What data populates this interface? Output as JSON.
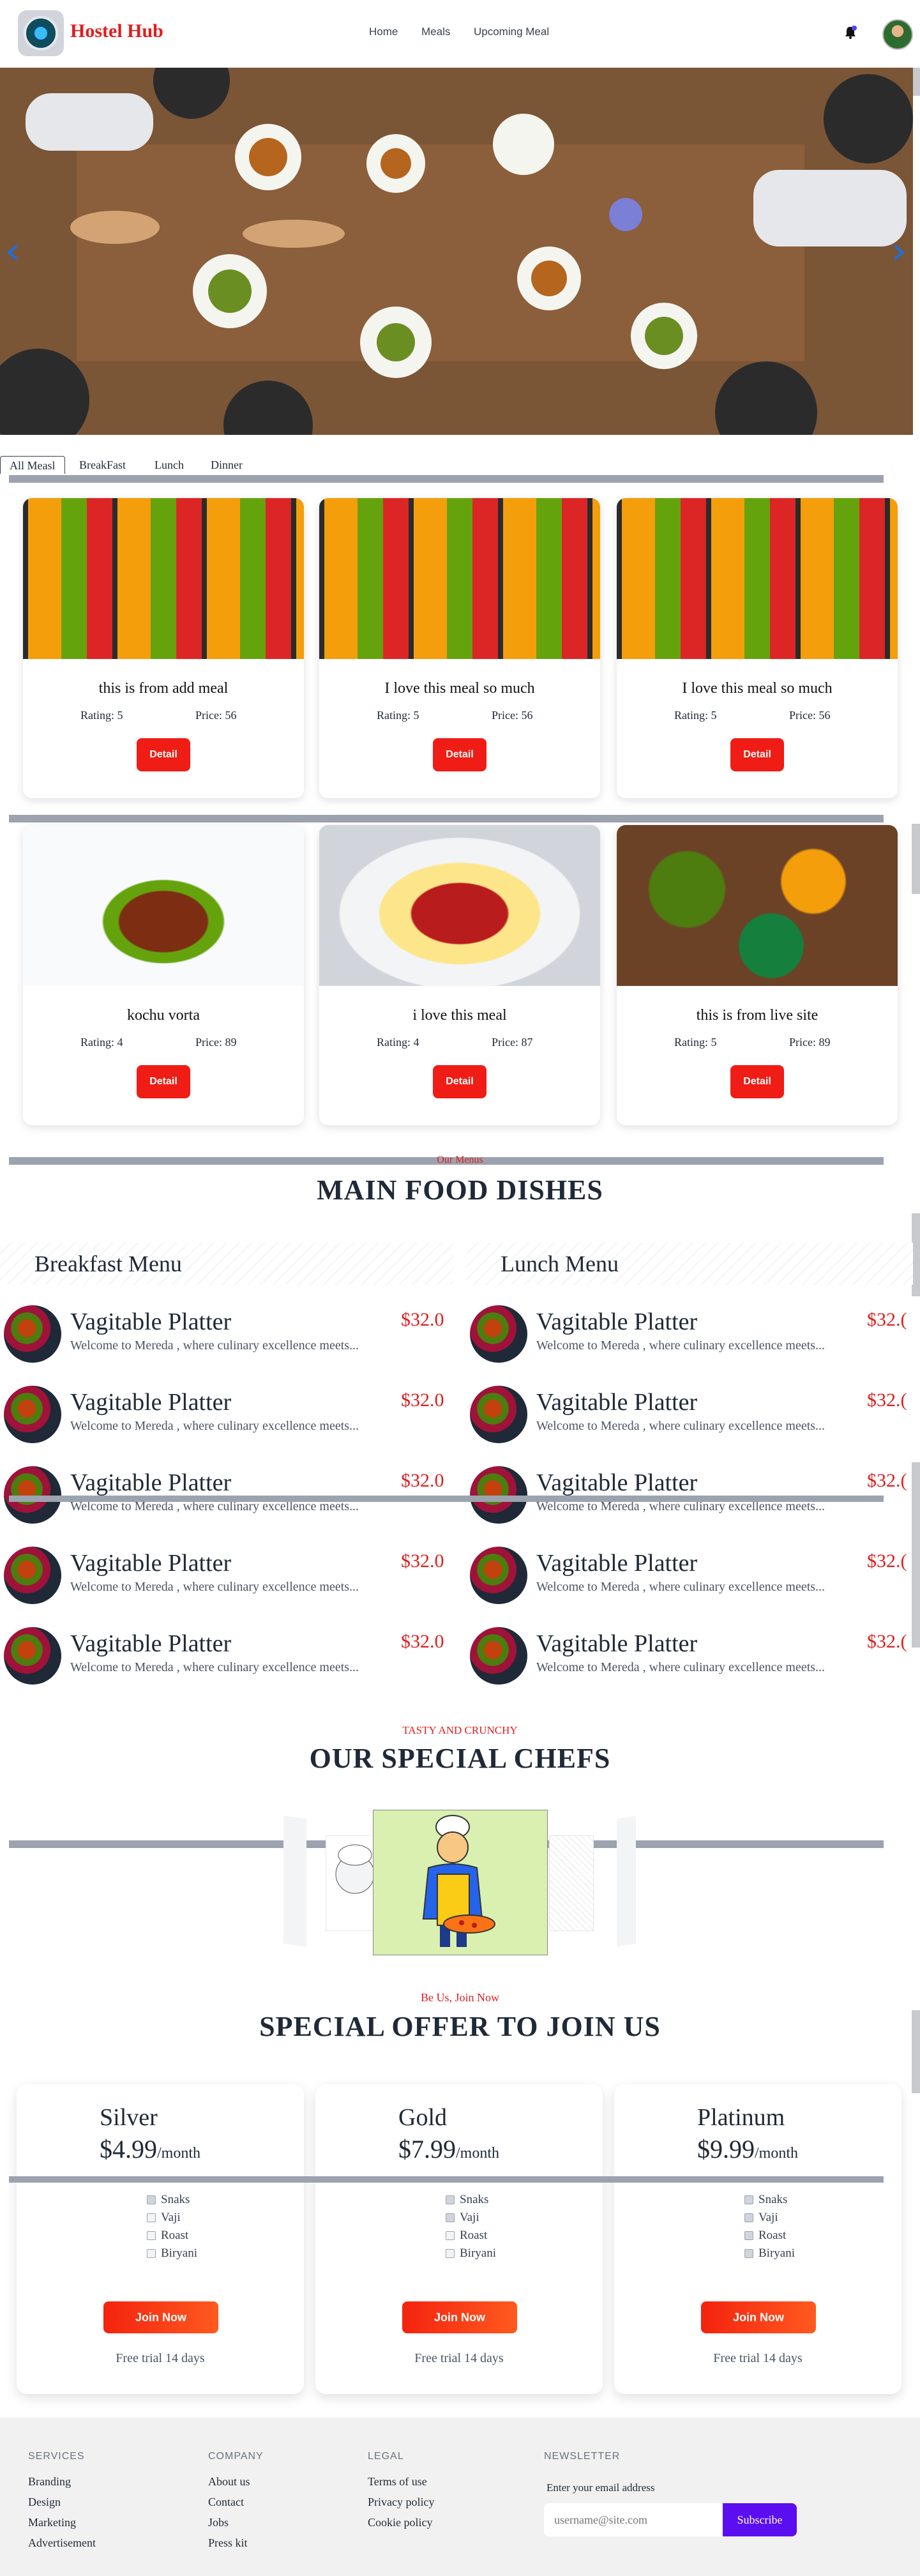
{
  "nav": {
    "brand": "Hostel Hub",
    "links": [
      "Home",
      "Meals",
      "Upcoming Meal"
    ]
  },
  "tabs": [
    "All Measl",
    "BreakFast",
    "Lunch",
    "Dinner"
  ],
  "cards": [
    {
      "title": "this is from add meal",
      "rating": "Rating: 5",
      "price": "Price: 56",
      "button": "Detail"
    },
    {
      "title": "I love this meal so much",
      "rating": "Rating: 5",
      "price": "Price: 56",
      "button": "Detail"
    },
    {
      "title": "I love this meal so much",
      "rating": "Rating: 5",
      "price": "Price: 56",
      "button": "Detail"
    },
    {
      "title": "kochu vorta",
      "rating": "Rating: 4",
      "price": "Price: 89",
      "button": "Detail"
    },
    {
      "title": "i love this meal",
      "rating": "Rating: 4",
      "price": "Price: 87",
      "button": "Detail"
    },
    {
      "title": "this is from live site",
      "rating": "Rating: 5",
      "price": "Price: 89",
      "button": "Detail"
    }
  ],
  "menu": {
    "eyebrow": "Our Menus",
    "heading": "MAIN FOOD DISHES",
    "breakfast_title": "Breakfast Menu",
    "lunch_title": "Lunch Menu",
    "item_name": "Vagitable Platter",
    "item_desc": "Welcome to Mereda , where culinary excellence meets...",
    "item_price": "$32.0",
    "item_price_cut": "$32.("
  },
  "chefs": {
    "eyebrow": "TASTY AND CRUNCHY",
    "heading": "OUR SPECIAL CHEFS"
  },
  "offer": {
    "eyebrow": "Be Us, Join Now",
    "heading": "SPECIAL OFFER TO JOIN US",
    "per": "/month",
    "join": "Join Now",
    "trial": "Free trial 14 days",
    "features": [
      "Snaks",
      "Vaji",
      "Roast",
      "Biryani"
    ],
    "plans": [
      {
        "name": "Silver",
        "price": "$4.99",
        "checked": [
          1,
          0,
          0,
          0
        ]
      },
      {
        "name": "Gold",
        "price": "$7.99",
        "checked": [
          1,
          1,
          0,
          0
        ]
      },
      {
        "name": "Platinum",
        "price": "$9.99",
        "checked": [
          1,
          1,
          1,
          1
        ]
      }
    ]
  },
  "footer": {
    "services": {
      "title": "SERVICES",
      "links": [
        "Branding",
        "Design",
        "Marketing",
        "Advertisement"
      ]
    },
    "company": {
      "title": "COMPANY",
      "links": [
        "About us",
        "Contact",
        "Jobs",
        "Press kit"
      ]
    },
    "legal": {
      "title": "LEGAL",
      "links": [
        "Terms of use",
        "Privacy policy",
        "Cookie policy"
      ]
    },
    "newsletter": {
      "title": "NEWSLETTER",
      "label": "Enter your email address",
      "placeholder": "username@site.com",
      "button": "Subscribe"
    }
  },
  "colors": {
    "accent": "#e11d1d",
    "button": "#ef1d15",
    "subscribe": "#5b0ef0"
  }
}
